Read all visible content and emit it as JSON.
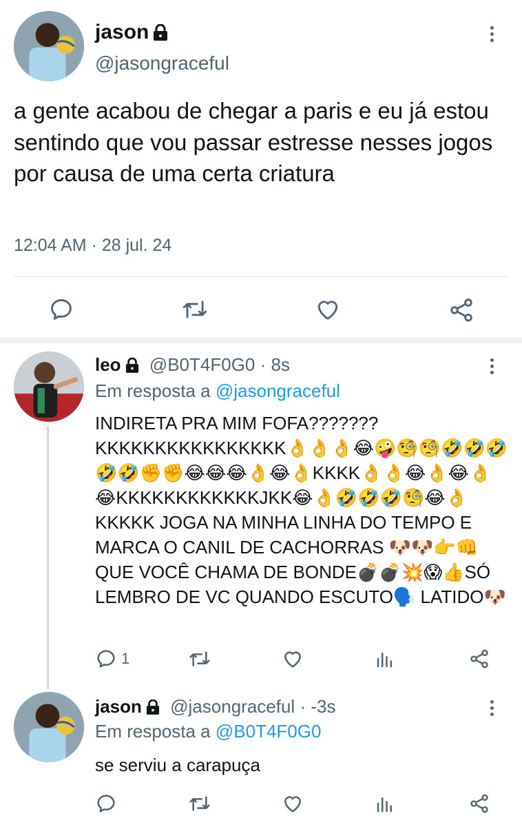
{
  "main_tweet": {
    "display_name": "jason",
    "handle": "@jasongraceful",
    "text": "a gente acabou de chegar a paris e eu já estou sentindo que vou passar estresse nesses jogos por causa de uma certa criatura",
    "timestamp": "12:04 AM · 28 jul. 24",
    "actions": [
      "reply-icon",
      "retweet-icon",
      "like-icon",
      "share-icon"
    ]
  },
  "reply1": {
    "display_name": "leo",
    "handle": "@B0T4F0G0",
    "time": "· 8s",
    "replying_label": "Em resposta a",
    "replying_to": "@jasongraceful",
    "text": "INDIRETA PRA MIM FOFA??????? KKKKKKKKKKKKKKKK👌👌👌😂🤪🧐🧐🤣🤣🤣🤣🤣✊✊😂😂😂👌😂👌KKKK👌👌😂👌😂👌😂KKKKKKKKKKKKJKK😂👌🤣🤣🤣🧐😂👌KKKKK JOGA NA MINHA LINHA DO TEMPO E MARCA O CANIL DE CACHORRAS 🐶🐶👉👊QUE VOCÊ CHAMA DE BONDE💣💣💥😱👍SÓ LEMBRO DE VC QUANDO ESCUTO🗣️ LATIDO🐶",
    "reply_count": "1",
    "actions": [
      "reply-icon",
      "retweet-icon",
      "like-icon",
      "views-icon",
      "share-icon"
    ]
  },
  "reply2": {
    "display_name": "jason",
    "handle": "@jasongraceful",
    "time": "· -3s",
    "replying_label": "Em resposta a",
    "replying_to": "@B0T4F0G0",
    "text": "se serviu a carapuça",
    "actions": [
      "reply-icon",
      "retweet-icon",
      "like-icon",
      "views-icon",
      "share-icon"
    ]
  },
  "colors": {
    "text": "#0f1419",
    "secondary": "#536471",
    "link": "#1d9bf0",
    "divider": "#dfe3e6"
  }
}
